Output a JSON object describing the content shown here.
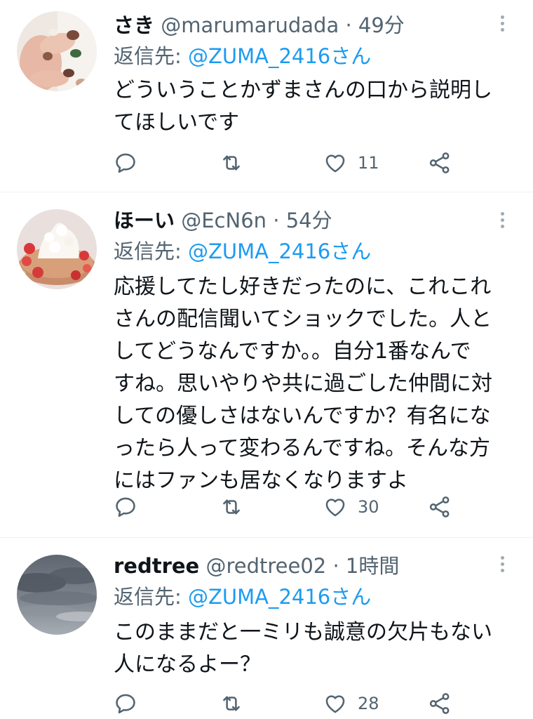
{
  "tweets": [
    {
      "name": "さき",
      "handle": "@marumarudada",
      "separator": "·",
      "time": "49分",
      "reply_label": "返信先: ",
      "reply_to": "@ZUMA_2416さん",
      "lines": [
        "どういうことかずまさんの口から説明し",
        "てほしいです"
      ],
      "likes": "11"
    },
    {
      "name": "ほーい",
      "handle": "@EcN6n",
      "separator": "·",
      "time": "54分",
      "reply_label": "返信先: ",
      "reply_to": "@ZUMA_2416さん",
      "lines": [
        "応援してたし好きだったのに、これこれ",
        "さんの配信聞いてショックでした。人と",
        "してどうなんですか。。自分1番なんで",
        "すね。思いやりや共に過ごした仲間に対",
        "しての優しさはないんですか？有名にな",
        "ったら人って変わるんですね。そんな方",
        "にはファンも居なくなりますよ"
      ],
      "likes": "30"
    },
    {
      "name": "redtree",
      "handle": "@redtree02",
      "separator": "·",
      "time": "1時間",
      "reply_label": "返信先: ",
      "reply_to": "@ZUMA_2416さん",
      "lines": [
        "このままだと一ミリも誠意の欠片もない",
        "人になるよー？"
      ],
      "likes": "28"
    }
  ],
  "icons": {
    "reply": "reply-icon",
    "retweet": "retweet-icon",
    "like": "heart-icon",
    "share": "share-icon",
    "more": "more-vertical-icon"
  },
  "colors": {
    "link": "#1d9bf0",
    "secondary": "#536471",
    "icon": "#536471",
    "divider": "#eff3f4"
  }
}
